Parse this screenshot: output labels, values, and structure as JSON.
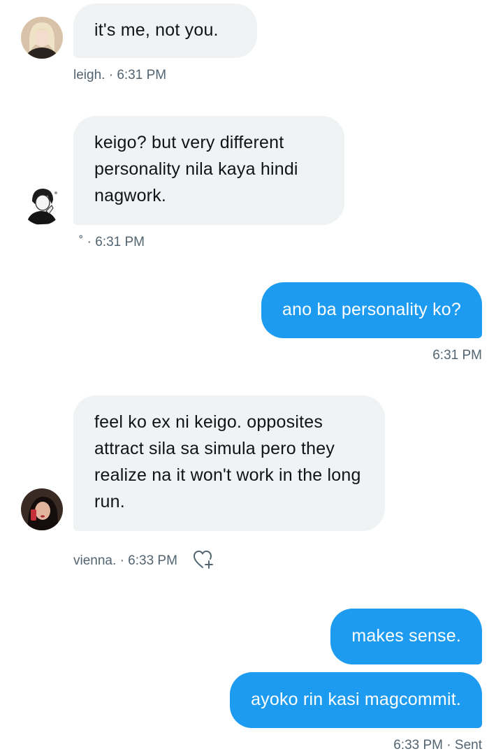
{
  "messages": [
    {
      "text": "it's me, not you.",
      "sender": "leigh.",
      "time": "6:31 PM"
    },
    {
      "text": "keigo? but very different personality nila kaya hindi nagwork.",
      "sender": "˚",
      "time": "6:31 PM"
    },
    {
      "text": "ano ba personality ko?",
      "time": "6:31 PM"
    },
    {
      "text": "feel ko ex ni keigo. opposites attract sila sa simula pero they realize na it won't work in the long run.",
      "sender": "vienna.",
      "time": "6:33 PM"
    },
    {
      "text": "makes sense."
    },
    {
      "text": "ayoko rin kasi magcommit.",
      "time": "6:33 PM",
      "status": "Sent"
    }
  ],
  "meta_separator": "·",
  "icons": {
    "add_reaction": "heart-plus-icon"
  },
  "colors": {
    "outgoing_bubble": "#1d9bf0",
    "incoming_bubble": "#eff3f4",
    "meta_text": "#536471"
  }
}
